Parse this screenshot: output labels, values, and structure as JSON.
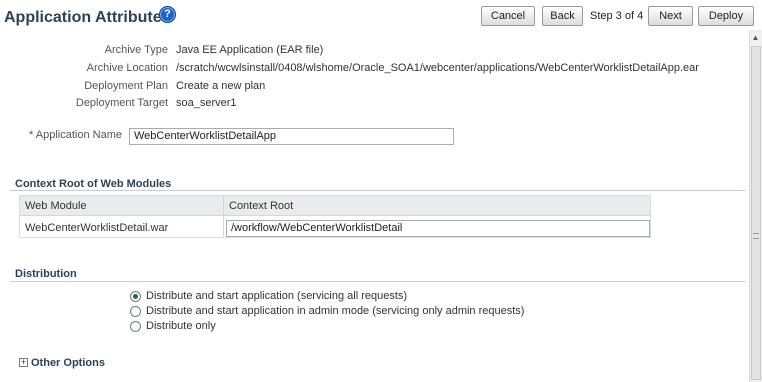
{
  "header": {
    "title": "Application Attributes",
    "help_glyph": "?",
    "buttons": {
      "cancel": "Cancel",
      "back": "Back",
      "next": "Next",
      "deploy": "Deploy"
    },
    "step_text": "Step 3 of 4"
  },
  "details": [
    {
      "label": "Archive Type",
      "value": "Java EE Application (EAR file)"
    },
    {
      "label": "Archive Location",
      "value": "/scratch/wcwlsinstall/0408/wlshome/Oracle_SOA1/webcenter/applications/WebCenterWorklistDetailApp.ear"
    },
    {
      "label": "Deployment Plan",
      "value": "Create a new plan"
    },
    {
      "label": "Deployment Target",
      "value": "soa_server1"
    }
  ],
  "application_name": {
    "label": "* Application Name",
    "value": "WebCenterWorklistDetailApp"
  },
  "context_root": {
    "section_title": "Context Root of Web Modules",
    "columns": [
      "Web Module",
      "Context Root"
    ],
    "rows": [
      {
        "module": "WebCenterWorklistDetail.war",
        "root": "/workflow/WebCenterWorklistDetail"
      }
    ]
  },
  "distribution": {
    "section_title": "Distribution",
    "options": [
      {
        "label": "Distribute and start application (servicing all requests)",
        "selected": true
      },
      {
        "label": "Distribute and start application in admin mode (servicing only admin requests)",
        "selected": false
      },
      {
        "label": "Distribute only",
        "selected": false
      }
    ]
  },
  "other_options": {
    "expand_glyph": "+",
    "label": "Other Options"
  },
  "icons": {
    "help": "help-icon",
    "expand": "plus-icon",
    "scroll_up": "scroll-up-arrow-icon"
  },
  "colors": {
    "title": "#2c4356",
    "help_blue": "#1c64c8",
    "section_rule": "#c7cfd6",
    "table_header": "#e8ecef"
  }
}
